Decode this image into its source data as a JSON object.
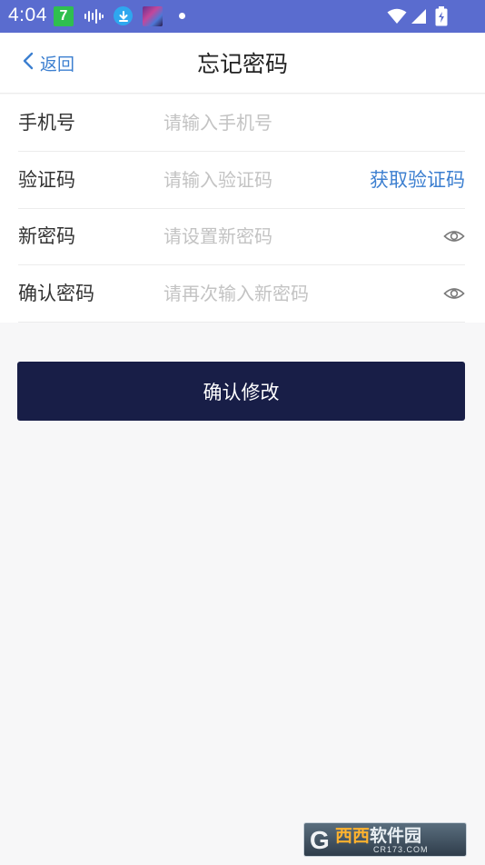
{
  "status_bar": {
    "time": "4:04",
    "app_badge": "7",
    "icons": [
      "sound-wave-icon",
      "download-icon",
      "app-thumbnail-icon",
      "notification-dot-icon",
      "wifi-icon",
      "signal-icon",
      "battery-charging-icon"
    ]
  },
  "header": {
    "back_label": "返回",
    "title": "忘记密码"
  },
  "form": {
    "phone": {
      "label": "手机号",
      "placeholder": "请输入手机号"
    },
    "code": {
      "label": "验证码",
      "placeholder": "请输入验证码",
      "get_code": "获取验证码"
    },
    "new_password": {
      "label": "新密码",
      "placeholder": "请设置新密码"
    },
    "confirm_password": {
      "label": "确认密码",
      "placeholder": "请再次输入新密码"
    }
  },
  "confirm_button": "确认修改",
  "watermark": {
    "mark": "G",
    "main_highlight": "西西",
    "main_rest": "软件园",
    "site": "CR173.COM"
  },
  "colors": {
    "status_bar": "#5a6ccf",
    "accent": "#3c7fd0",
    "primary_button": "#181e47",
    "background": "#f7f7f8"
  }
}
